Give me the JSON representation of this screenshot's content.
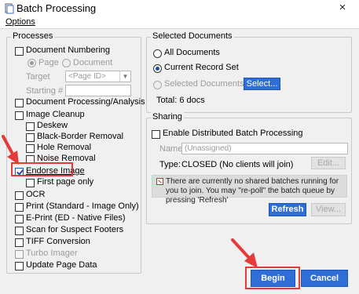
{
  "window": {
    "title": "Batch Processing",
    "close_glyph": "×",
    "menu_options": "Options"
  },
  "processes": {
    "legend": "Processes",
    "document_numbering": "Document Numbering",
    "radio_page": "Page",
    "radio_document": "Document",
    "target_label": "Target",
    "target_value": "<Page ID>",
    "starting_label": "Starting #",
    "starting_value": "",
    "document_processing": "Document Processing/Analysis",
    "image_cleanup": "Image Cleanup",
    "deskew": "Deskew",
    "black_border_removal": "Black-Border Removal",
    "hole_removal": "Hole Removal",
    "noise_removal": "Noise Removal",
    "endorse_image": "Endorse Image",
    "endorse_image_checked": true,
    "first_page_only": "First page only",
    "ocr": "OCR",
    "print": "Print  (Standard - Image Only)",
    "eprint": "E-Print (ED - Native Files)",
    "scan_suspect_footers": "Scan for Suspect Footers",
    "tiff_conversion": "TIFF Conversion",
    "turbo_imager": "Turbo Imager",
    "update_page_data": "Update Page Data"
  },
  "selected_documents": {
    "legend": "Selected Documents",
    "all_documents": "All Documents",
    "current_record_set": "Current Record Set",
    "current_record_set_selected": true,
    "selected_documents": "Selected Documents",
    "select_button": "Select...",
    "total": "Total:  6 docs"
  },
  "sharing": {
    "legend": "Sharing",
    "enable_distributed": "Enable Distributed Batch Processing",
    "name_label": "Name:",
    "name_placeholder": "(Unassigned)",
    "type_label": "Type:",
    "type_value": "CLOSED (No clients will join)",
    "edit_button": "Edit...",
    "message": "There are currently no shared batches running for you to join.  You may \"re-poll\" the batch queue by pressing 'Refresh'",
    "refresh_button": "Refresh",
    "view_button": "View..."
  },
  "footer": {
    "begin_button": "Begin",
    "cancel_button": "Cancel"
  },
  "colors": {
    "accent_blue": "#2e6ed6",
    "highlight_red": "#e53a3a"
  },
  "icons": {
    "app": "document-icon",
    "close": "close-icon",
    "info": "warning-icon",
    "arrows": "red-annotation-arrow-icon"
  }
}
